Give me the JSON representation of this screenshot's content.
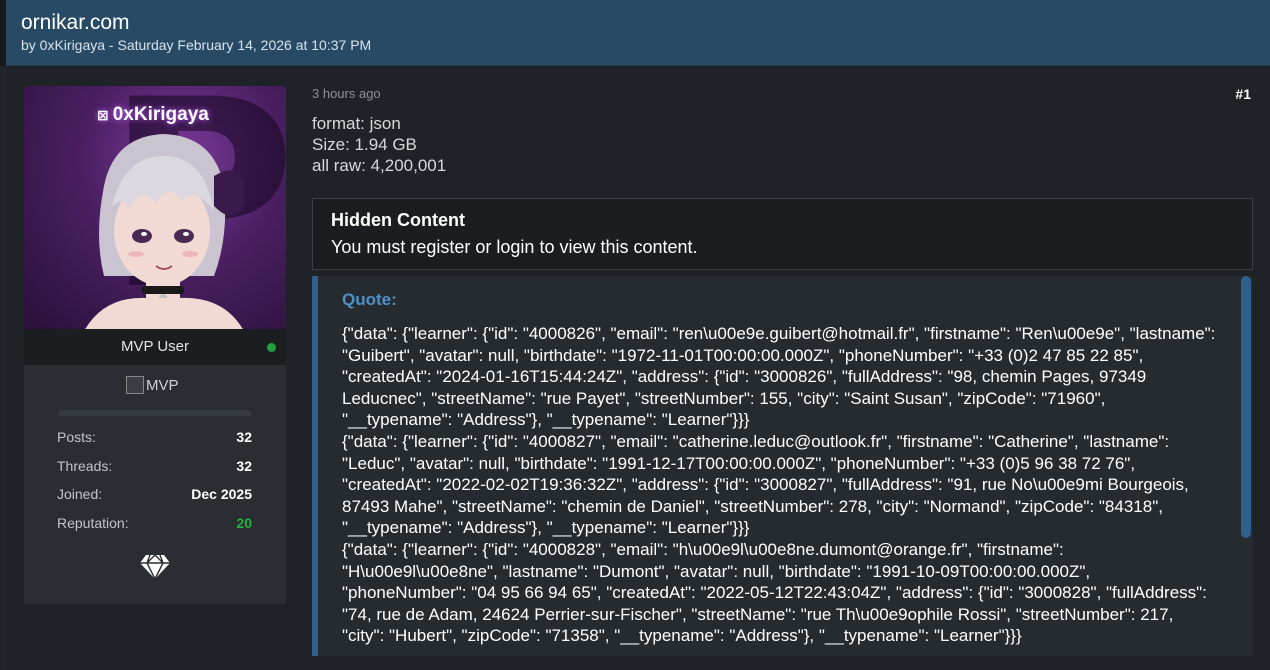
{
  "thread": {
    "title": "ornikar.com",
    "byline": "by 0xKirigaya - Saturday February 14, 2026 at 10:37 PM"
  },
  "user": {
    "avatar_name": "0xKirigaya",
    "avatar_symbol": "⊠",
    "role": "MVP User",
    "online": true,
    "badge_alt": "MVP",
    "stats": [
      {
        "label": "Posts:",
        "value": "32"
      },
      {
        "label": "Threads:",
        "value": "32"
      },
      {
        "label": "Joined:",
        "value": "Dec 2025"
      },
      {
        "label": "Reputation:",
        "value": "20"
      }
    ],
    "rank_icon": "diamond-icon"
  },
  "post": {
    "time": "3 hours ago",
    "number": "#1",
    "info": [
      "format: json",
      "Size: 1.94 GB",
      "all raw: 4,200,001"
    ],
    "hidden": {
      "title": "Hidden Content",
      "text": "You must register or login to view this content."
    },
    "quote": {
      "label": "Quote:",
      "body": "{\"data\": {\"learner\": {\"id\": \"4000826\", \"email\": \"ren\\u00e9e.guibert@hotmail.fr\", \"firstname\": \"Ren\\u00e9e\", \"lastname\": \"Guibert\", \"avatar\": null, \"birthdate\": \"1972-11-01T00:00:00.000Z\", \"phoneNumber\": \"+33 (0)2 47 85 22 85\", \"createdAt\": \"2024-01-16T15:44:24Z\", \"address\": {\"id\": \"3000826\", \"fullAddress\": \"98, chemin Pages, 97349 Leducnec\", \"streetName\": \"rue Payet\", \"streetNumber\": 155, \"city\": \"Saint Susan\", \"zipCode\": \"71960\", \"__typename\": \"Address\"}, \"__typename\": \"Learner\"}}}\n{\"data\": {\"learner\": {\"id\": \"4000827\", \"email\": \"catherine.leduc@outlook.fr\", \"firstname\": \"Catherine\", \"lastname\": \"Leduc\", \"avatar\": null, \"birthdate\": \"1991-12-17T00:00:00.000Z\", \"phoneNumber\": \"+33 (0)5 96 38 72 76\", \"createdAt\": \"2022-02-02T19:36:32Z\", \"address\": {\"id\": \"3000827\", \"fullAddress\": \"91, rue No\\u00e9mi Bourgeois, 87493 Mahe\", \"streetName\": \"chemin de Daniel\", \"streetNumber\": 278, \"city\": \"Normand\", \"zipCode\": \"84318\", \"__typename\": \"Address\"}, \"__typename\": \"Learner\"}}}\n{\"data\": {\"learner\": {\"id\": \"4000828\", \"email\": \"h\\u00e9l\\u00e8ne.dumont@orange.fr\", \"firstname\": \"H\\u00e9l\\u00e8ne\", \"lastname\": \"Dumont\", \"avatar\": null, \"birthdate\": \"1991-10-09T00:00:00.000Z\", \"phoneNumber\": \"04 95 66 94 65\", \"createdAt\": \"2022-05-12T22:43:04Z\", \"address\": {\"id\": \"3000828\", \"fullAddress\": \"74, rue de Adam, 24624 Perrier-sur-Fischer\", \"streetName\": \"rue Th\\u00e9ophile Rossi\", \"streetNumber\": 217, \"city\": \"Hubert\", \"zipCode\": \"71358\", \"__typename\": \"Address\"}, \"__typename\": \"Learner\"}}}"
    }
  },
  "colors": {
    "header_bg": "#294a64",
    "accent_blue": "#2f5f8c",
    "quote_label": "#4f90c8",
    "online_green": "#21a040",
    "reputation_green": "#21b33d"
  }
}
